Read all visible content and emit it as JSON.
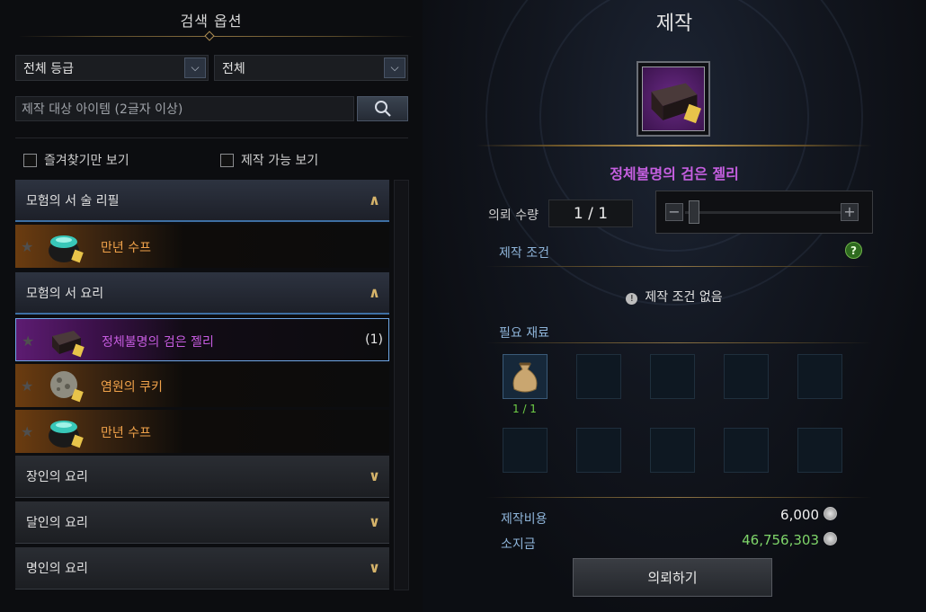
{
  "left": {
    "title": "검색 옵션",
    "grade_select": "전체 등급",
    "type_select": "전체",
    "search_placeholder": "제작 대상 아이템 (2글자 이상)",
    "checkbox_favorites": "즐겨찾기만 보기",
    "checkbox_craftable": "제작 가능 보기",
    "categories": [
      {
        "label": "모험의 서 술 리필",
        "open": true
      },
      {
        "label": "모험의 서 요리",
        "open": true
      },
      {
        "label": "장인의 요리",
        "open": false
      },
      {
        "label": "달인의 요리",
        "open": false
      },
      {
        "label": "명인의 요리",
        "open": false
      }
    ],
    "items": [
      {
        "name": "만년 수프",
        "count": ""
      },
      {
        "name": "정체불명의 검은 젤리",
        "count": "(1)"
      },
      {
        "name": "염원의 쿠키",
        "count": ""
      },
      {
        "name": "만년 수프",
        "count": ""
      }
    ]
  },
  "right": {
    "title": "제작",
    "item_name": "정체불명의 검은 젤리",
    "qty_label": "의뢰 수량",
    "qty_value": "1 / 1",
    "conditions_header": "제작 조건",
    "no_conditions": "제작 조건 없음",
    "materials_header": "필요 재료",
    "material_count": "1 / 1",
    "cost_label": "제작비용",
    "cost_value": "6,000",
    "gold_label": "소지금",
    "gold_value": "46,756,303",
    "request_button": "의뢰하기",
    "help_symbol": "?"
  }
}
